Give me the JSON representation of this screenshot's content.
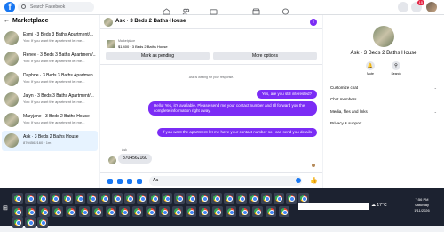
{
  "topbar": {
    "logo": "f",
    "search_placeholder": "Search Facebook",
    "notification_count": "15",
    "colors": {
      "brand": "#1877f2",
      "accent": "#7b2cf5"
    }
  },
  "sidebar": {
    "title": "Marketplace",
    "conversations": [
      {
        "name": "Esmi · 3 Beds 3 Baths Apartment/...",
        "snippet": "You: If you want the apartment let me...",
        "active": false
      },
      {
        "name": "Renee · 3 Beds 3 Baths Apartment/...",
        "snippet": "You: If you want the apartment let me...",
        "active": false
      },
      {
        "name": "Daphne · 3 Beds 3 Baths Apartmen...",
        "snippet": "You: If you want the apartment let me...",
        "active": false
      },
      {
        "name": "Jalyn · 3 Beds 3 Baths Apartment/...",
        "snippet": "You: If you want the apartment let me...",
        "active": false
      },
      {
        "name": "Maryjane · 3 Beds 2 Baths House",
        "snippet": "You: If you want the apartment let me...",
        "active": false
      },
      {
        "name": "Ask · 3 Beds 2 Baths House",
        "snippet": "8704562160 · 1m",
        "active": true
      }
    ]
  },
  "chat": {
    "title": "Ask · 3 Beds 2 Baths House",
    "listing_category": "Marketplace",
    "listing_title": "$1,400 · 3 Beds 2 Baths House",
    "mark_pending_label": "Mark as pending",
    "more_options_label": "More options",
    "system_message": "Ask is waiting for your response.",
    "messages_out": [
      "Yes, are you still interested?",
      "Hello! Yes, it's available. Please send me your contact number and I'll forward you the complete information right away.",
      "If you want the apartment let me have your contact number so i can send you details"
    ],
    "incoming_sender": "Ask",
    "incoming_message": "8704562160",
    "composer_value": "Aa"
  },
  "details": {
    "title": "Ask · 3 Beds 2 Baths House",
    "mute_label": "Mute",
    "search_label": "Search",
    "sections": [
      "Customize chat",
      "Chat members",
      "Media, files and links",
      "Privacy & support"
    ]
  },
  "taskbar": {
    "temperature": "17°C",
    "time": "7:56 PM",
    "day": "Saturday",
    "date": "1/11/2026"
  }
}
